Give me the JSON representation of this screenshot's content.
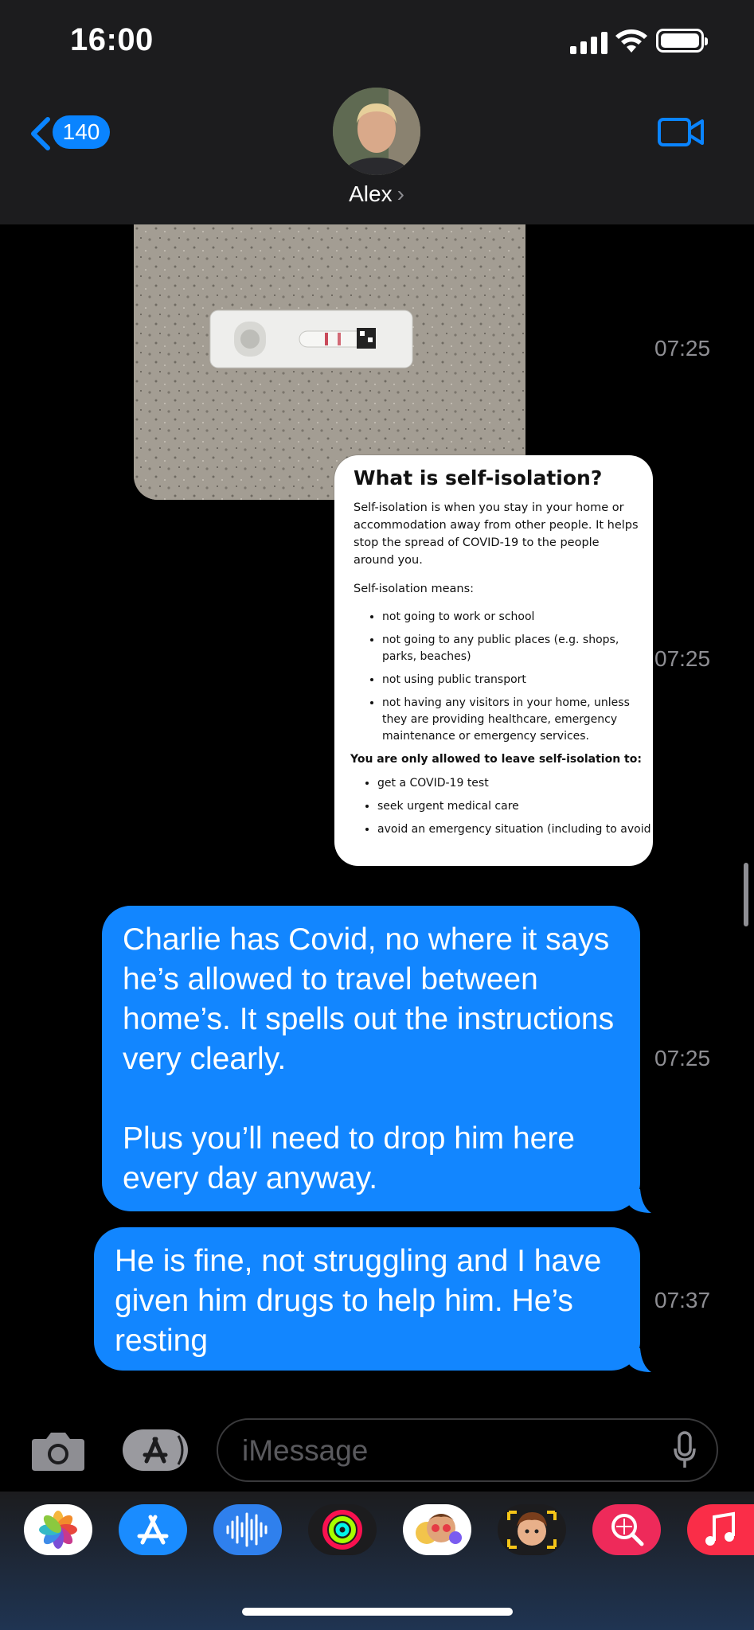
{
  "status_bar": {
    "time": "16:00"
  },
  "header": {
    "back_count": "140",
    "contact_name": "Alex",
    "contact_chevron": "›"
  },
  "messages": [
    {
      "type": "image",
      "description_icon": "covid-test-photo",
      "timestamp": "07:25"
    },
    {
      "type": "image-document",
      "timestamp": "07:25",
      "document": {
        "title": "What is self-isolation?",
        "intro": "Self-isolation is when you stay in your home or accommodation away from other people. It helps stop the spread of COVID-19 to the people around you.",
        "means_label": "Self-isolation means:",
        "means_items": [
          "not going to work or school",
          "not going to any public places (e.g. shops, parks, beaches)",
          "not using public transport",
          "not having any visitors in your home, unless they are providing healthcare, emergency maintenance or emergency services."
        ],
        "allowed_label": "You are only allowed to leave self-isolation to:",
        "allowed_items": [
          "get a COVID-19 test",
          "seek urgent medical care",
          "avoid an emergency situation (including to avoid"
        ]
      }
    },
    {
      "type": "text",
      "timestamp": "07:25",
      "paragraphs": [
        "Charlie has Covid, no where it says he’s allowed to travel between home’s. It spells out the instructions very clearly.",
        "Plus you’ll need to drop him here every day anyway."
      ]
    },
    {
      "type": "text",
      "timestamp": "07:37",
      "paragraphs": [
        "He is fine, not struggling and I have given him drugs to help him. He’s resting"
      ]
    }
  ],
  "input_bar": {
    "placeholder": "iMessage"
  },
  "app_drawer": [
    {
      "name": "photos-app-icon"
    },
    {
      "name": "app-store-icon"
    },
    {
      "name": "audio-message-icon"
    },
    {
      "name": "activity-icon"
    },
    {
      "name": "memoji-stickers-icon"
    },
    {
      "name": "memoji-icon"
    },
    {
      "name": "image-search-icon"
    },
    {
      "name": "music-icon"
    }
  ],
  "colors": {
    "bubble_blue": "#1286ff",
    "link_blue": "#0a84ff",
    "header_bg": "#1c1c1e",
    "timestamp_gray": "#8e8e93"
  }
}
